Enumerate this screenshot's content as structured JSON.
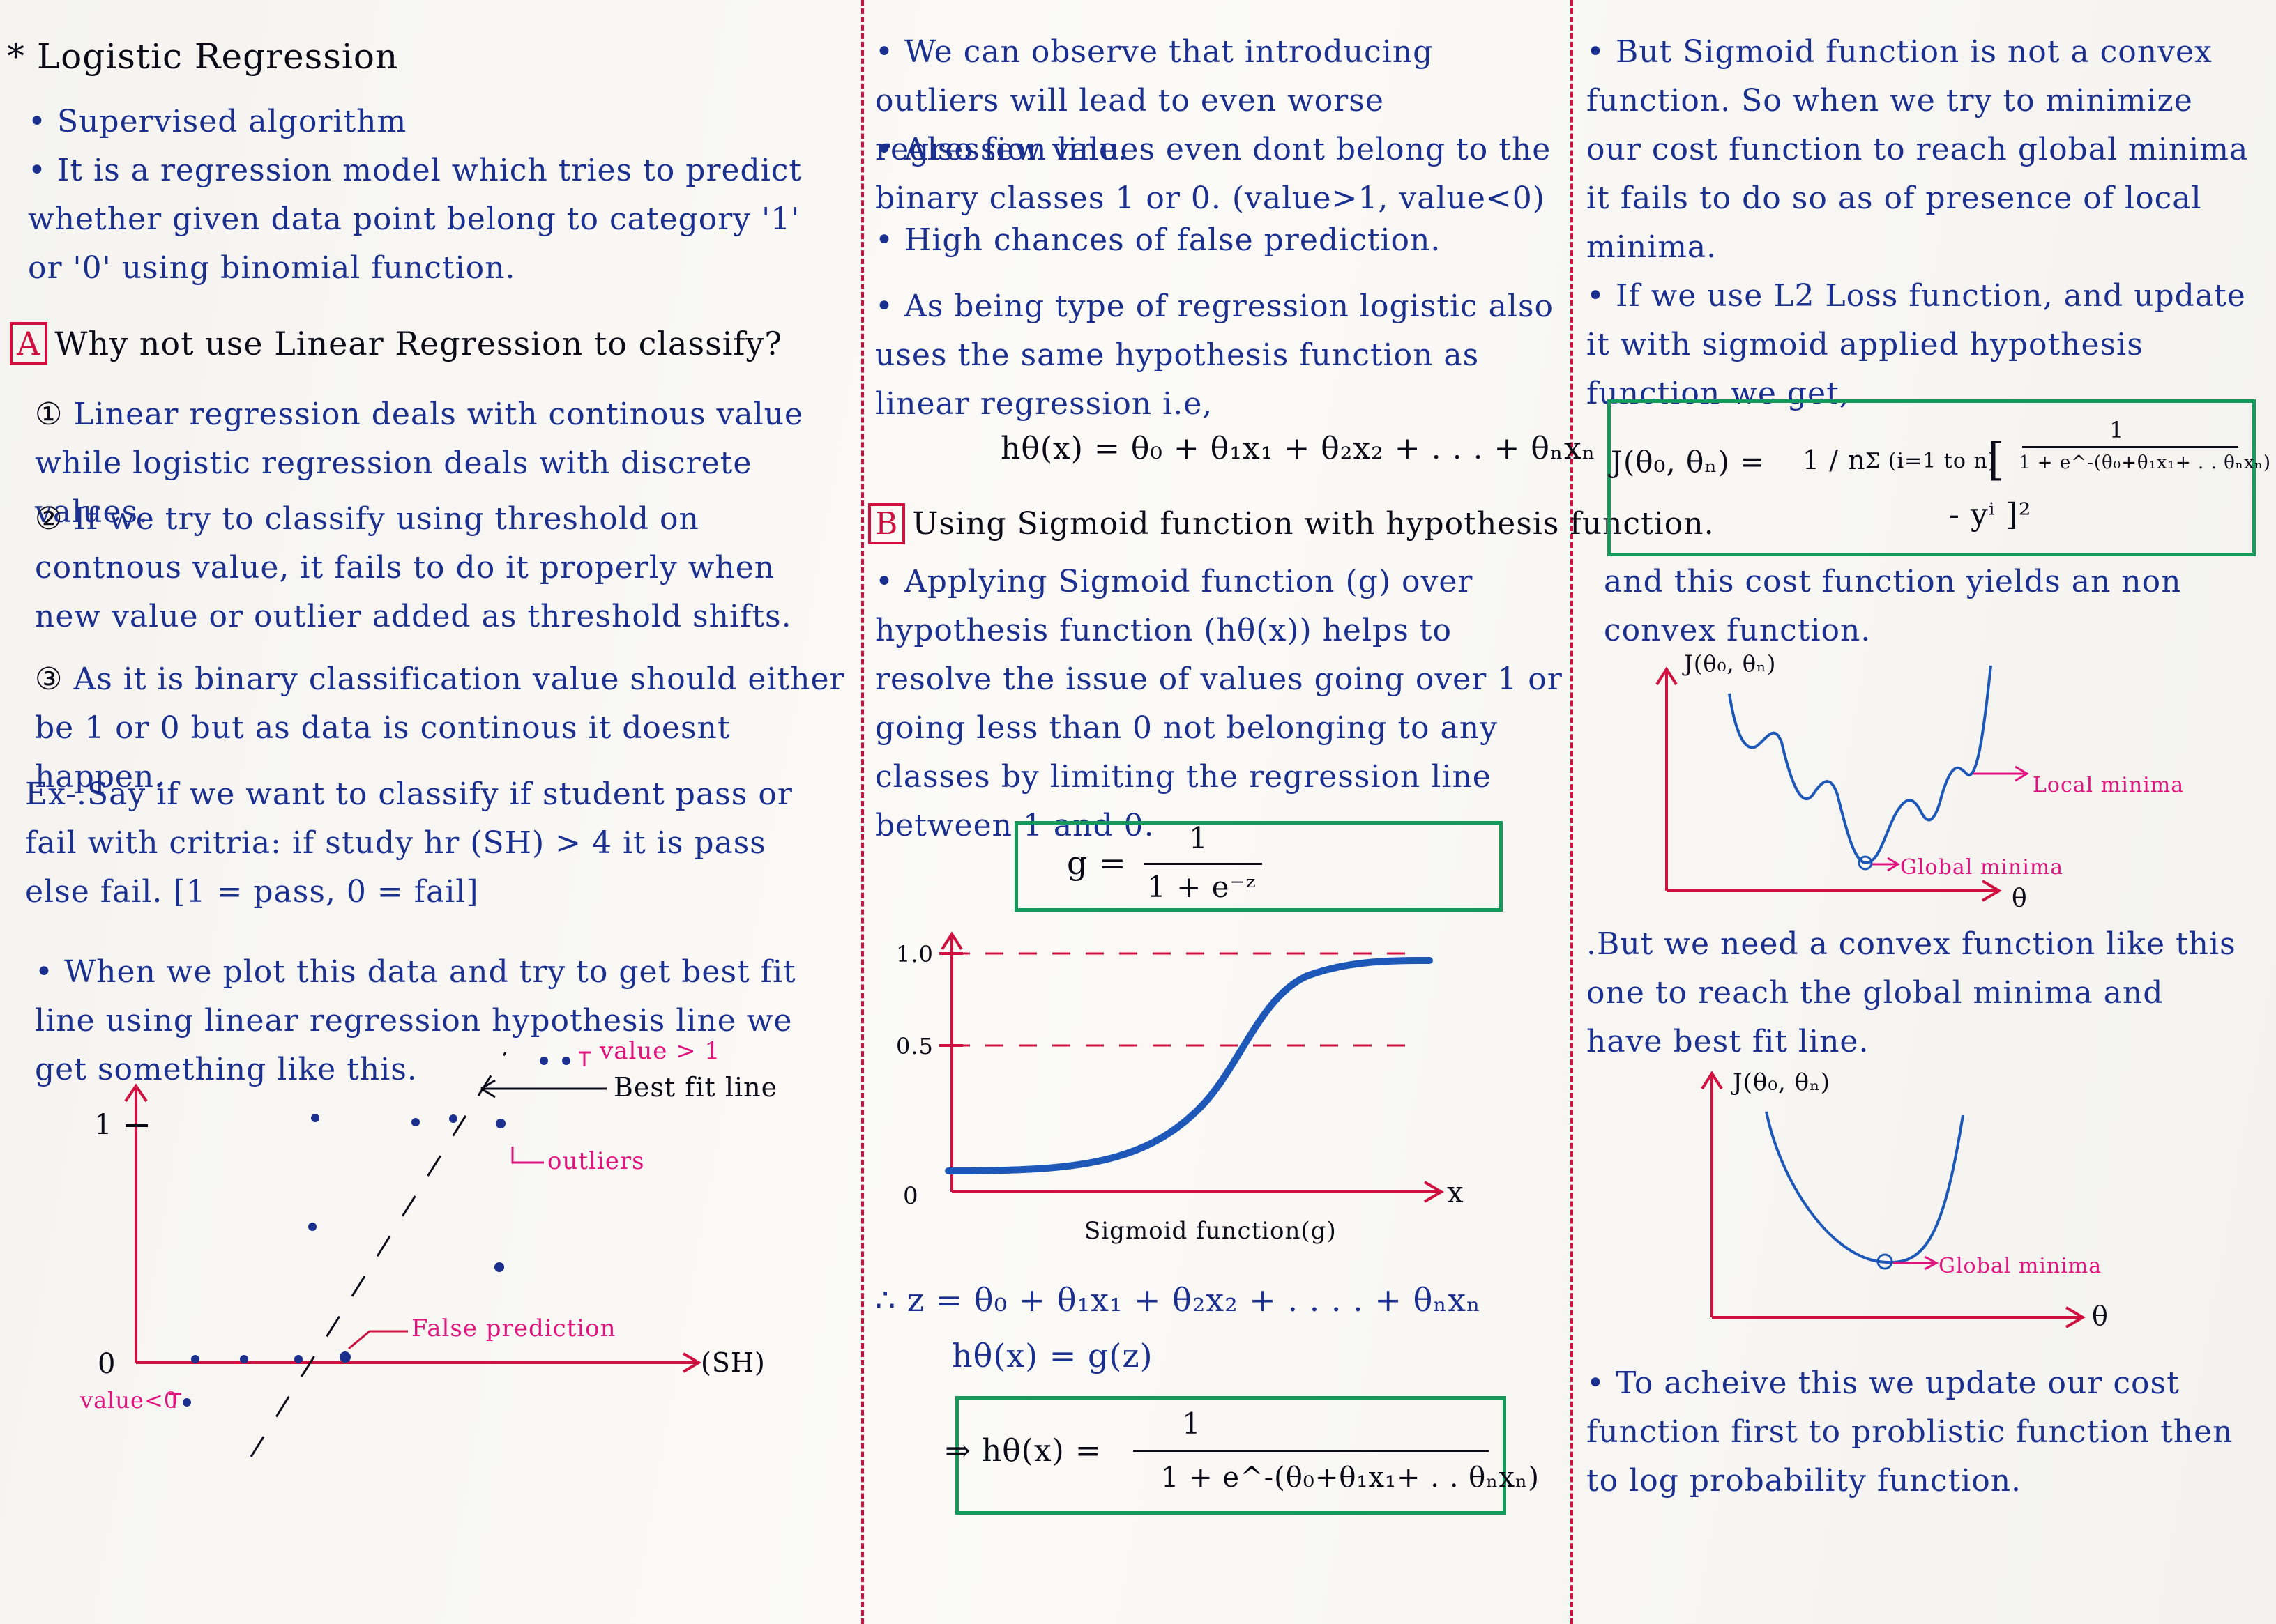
{
  "colors": {
    "ink": "#1b2f8f",
    "dark": "#0b0b18",
    "red": "#d0103f",
    "pink": "#e0147e",
    "green": "#169a5c",
    "curve": "#1d57b8"
  },
  "col1": {
    "title": "* Logistic Regression",
    "bullet_supervised": "Supervised algorithm",
    "bullet_model": "It is a regression model which tries to predict whether given data point belong to category '1' or '0' using binomial function.",
    "section_a_label": "A",
    "section_a_title": "Why not use Linear Regression to classify?",
    "point1": "Linear regression deals with continous value while logistic regression deals with discrete values.",
    "point2": "If we try to classify using threshold on contnous value, it fails to do it properly when new value or outlier added as threshold shifts.",
    "point3": "As it is binary classification value should either be 1 or 0 but as data is continous it doesnt happen.",
    "example": "Ex-.Say if we want to classify if student pass or fail with critria: if study hr (SH) > 4 it is pass else fail. [1 = pass, 0 = fail]",
    "bullet_plot": "When we plot this data and try to get best fit line using linear regression hypothesis line we get something like this.",
    "plot": {
      "value_gt1": "value > 1",
      "best_fit": "Best fit line",
      "outliers": "outliers",
      "false_pred": "False prediction",
      "x_axis": "(SH)",
      "y_one": "1",
      "origin": "0",
      "value_lt0": "value<0"
    }
  },
  "col2": {
    "bullet_outliers": "We can observe that introducing outliers will lead to even worse regression line.",
    "bullet_few_values": "Also few values even dont belong to the binary classes 1 or 0. (value>1, value<0)",
    "bullet_false": "High chances of false prediction.",
    "bullet_type": "As being type of regression logistic also uses the same hypothesis function as linear regression i.e,",
    "hypothesis": "hθ(x) = θ₀ + θ₁x₁ + θ₂x₂ + . . . + θₙxₙ",
    "section_b_label": "B",
    "section_b_title": "Using Sigmoid function with hypothesis function.",
    "bullet_apply": "Applying Sigmoid function (g) over hypothesis function (hθ(x)) helps to resolve the issue of values going over 1 or going less than 0 not belonging to any classes by limiting the regression line between 1 and 0.",
    "g_lhs": "g =",
    "g_num": "1",
    "g_den": "1 + e⁻ᶻ",
    "plot": {
      "y1": "1.0",
      "y05": "0.5",
      "y0": "0",
      "x": "x",
      "caption": "Sigmoid function(g)"
    },
    "z_line": "∴  z = θ₀ + θ₁x₁ + θ₂x₂ + . . . . + θₙxₙ",
    "h_line": "hθ(x) = g(z)",
    "final_lhs": "⇒  hθ(x) =",
    "final_num": "1",
    "final_den": "1 + e^-(θ₀+θ₁x₁+ . . θₙxₙ)"
  },
  "col3": {
    "bullet_convex": "But Sigmoid function is not a convex function. So when we try to minimize our cost function to reach global minima it fails to do so as of presence of local minima.",
    "bullet_l2": "If we use L2 Loss function, and update it with sigmoid applied hypothesis function we get,",
    "cost_lhs": "J(θ₀, θₙ) =",
    "cost_frac": "1 / n",
    "cost_sum": "Σ (i=1 to n)",
    "cost_bracket": "[",
    "cost_inner_num": "1",
    "cost_inner_den": "1 + e^-(θ₀+θ₁x₁+ . . θₙxₙ)",
    "cost_tail": "- yⁱ ]²",
    "yields": "and this cost function yields an non convex function.",
    "nonconvex": {
      "ylabel": "J(θ₀, θₙ)",
      "local": "Local minima",
      "global": "Global minima",
      "x": "θ"
    },
    "bullet_need": ".But we need a convex function like this one to reach the global minima and have best fit line.",
    "convex": {
      "ylabel": "J(θ₀, θₙ)",
      "global": "Global minima",
      "x": "θ"
    },
    "bullet_achieve": "To acheive this we update our cost function first to problistic function then to log probability function."
  }
}
